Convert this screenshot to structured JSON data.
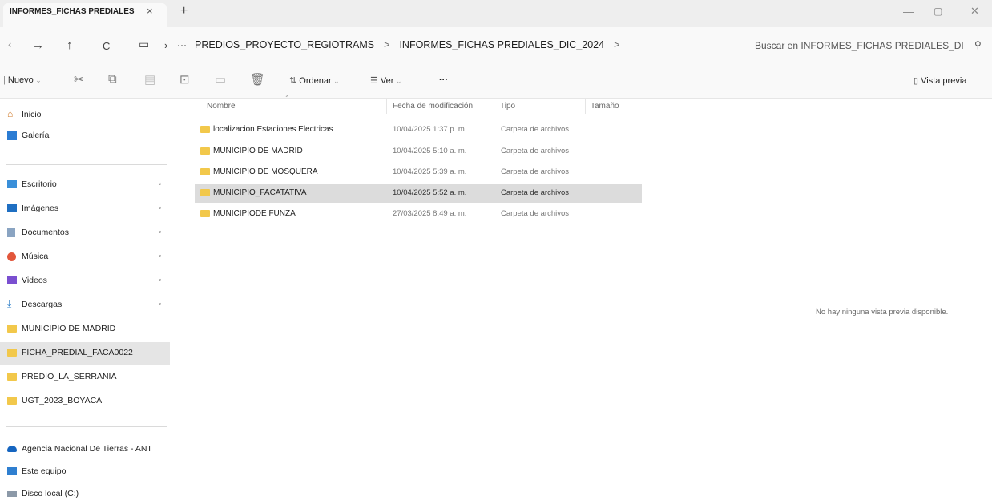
{
  "tab": {
    "title": "INFORMES_FICHAS PREDIALES",
    "close": "×",
    "new_tab": "+"
  },
  "window": {
    "minimize": "—",
    "maximize": "▢",
    "close": "✕"
  },
  "nav": {
    "forward": "→",
    "up": "↑",
    "refresh": "C",
    "view": "▭",
    "chevron": "›",
    "more": "···"
  },
  "breadcrumb": {
    "items": [
      "PREDIOS_PROYECTO_REGIOTRAMS",
      "INFORMES_FICHAS PREDIALES_DIC_2024"
    ],
    "sep": ">"
  },
  "search": {
    "placeholder": "Buscar en INFORMES_FICHAS PREDIALES_DI",
    "icon": "search-icon"
  },
  "toolbar": {
    "new_label": "Nuevo",
    "sort_label": "Ordenar",
    "view_label": "Ver",
    "more_label": "···",
    "preview_label": "Vista previa"
  },
  "sidebar": {
    "quick": [
      {
        "label": "Inicio",
        "icon": "home-icon"
      },
      {
        "label": "Galería",
        "icon": "gallery-icon"
      }
    ],
    "pinned": [
      {
        "label": "Escritorio",
        "icon": "desktop-icon"
      },
      {
        "label": "Imágenes",
        "icon": "pictures-icon"
      },
      {
        "label": "Documentos",
        "icon": "documents-icon"
      },
      {
        "label": "Música",
        "icon": "music-icon"
      },
      {
        "label": "Videos",
        "icon": "videos-icon"
      },
      {
        "label": "Descargas",
        "icon": "downloads-icon"
      }
    ],
    "folders": [
      {
        "label": "MUNICIPIO DE MADRID"
      },
      {
        "label": "FICHA_PREDIAL_FACA0022"
      },
      {
        "label": "PREDIO_LA_SERRANIA"
      },
      {
        "label": "UGT_2023_BOYACA"
      }
    ],
    "locations": [
      {
        "label": "Agencia Nacional De Tierras - ANT",
        "icon": "cloud-icon"
      },
      {
        "label": "Este equipo",
        "icon": "computer-icon"
      },
      {
        "label": "Disco local (C:)",
        "icon": "drive-icon"
      }
    ]
  },
  "columns": {
    "name": "Nombre",
    "date": "Fecha de modificación",
    "type": "Tipo",
    "size": "Tamaño"
  },
  "files": [
    {
      "name": "localizacion Estaciones Electricas",
      "date": "10/04/2025 1:37 p. m.",
      "type": "Carpeta de archivos"
    },
    {
      "name": "MUNICIPIO DE MADRID",
      "date": "10/04/2025 5:10 a. m.",
      "type": "Carpeta de archivos"
    },
    {
      "name": "MUNICIPIO DE MOSQUERA",
      "date": "10/04/2025 5:39 a. m.",
      "type": "Carpeta de archivos"
    },
    {
      "name": "MUNICIPIO_FACATATIVA",
      "date": "10/04/2025 5:52 a. m.",
      "type": "Carpeta de archivos"
    },
    {
      "name": "MUNICIPIODE FUNZA",
      "date": "27/03/2025 8:49 a. m.",
      "type": "Carpeta de archivos"
    }
  ],
  "preview": {
    "message": "No hay ninguna vista previa disponible."
  },
  "colors": {
    "folder": "#f2c84b",
    "selection": "#dcdcdc",
    "accent": "#0067c0"
  }
}
